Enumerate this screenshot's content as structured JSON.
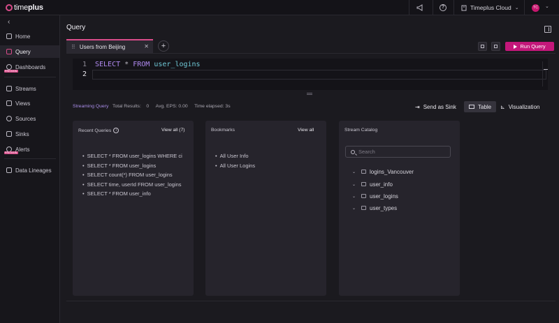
{
  "topbar": {
    "logo_prefix": "time",
    "logo_suffix": "plus",
    "workspace": "Timeplus Cloud",
    "avatar_initials": "TC"
  },
  "sidebar": {
    "items": [
      {
        "label": "Home"
      },
      {
        "label": "Query",
        "active": true
      },
      {
        "label": "Dashboards",
        "badge": "PREVIEW"
      },
      {
        "label": "Streams"
      },
      {
        "label": "Views"
      },
      {
        "label": "Sources"
      },
      {
        "label": "Sinks"
      },
      {
        "label": "Alerts",
        "badge": "PREVIEW"
      },
      {
        "label": "Data Lineages"
      }
    ]
  },
  "page": {
    "title": "Query"
  },
  "tabs": [
    {
      "label": "Users from Beijing"
    }
  ],
  "run_button": "Run Query",
  "editor": {
    "lines": [
      "1",
      "2"
    ],
    "keyword_select": "SELECT",
    "star": "*",
    "keyword_from": "FROM",
    "table": "user_logins"
  },
  "status": {
    "mode": "Streaming Query",
    "total_results_label": "Total Results:",
    "total_results": "0",
    "eps": "Avg. EPS: 0.00",
    "elapsed": "Time elapsed: 3s"
  },
  "views": {
    "sink": "Send as Sink",
    "table": "Table",
    "visualization": "Visualization"
  },
  "recent": {
    "title": "Recent Queries",
    "action": "View all (7)",
    "items": [
      "SELECT * FROM user_logins WHERE ci",
      "SELECT * FROM user_logins",
      "SELECT count(*) FROM user_logins",
      "SELECT time, userId FROM user_logins",
      "SELECT * FROM user_info"
    ]
  },
  "bookmarks": {
    "title": "Bookmarks",
    "action": "View all",
    "items": [
      "All User Info",
      "All User Logins"
    ]
  },
  "catalog": {
    "title": "Stream Catalog",
    "search_placeholder": "Search",
    "streams": [
      "logins_Vancouver",
      "user_info",
      "user_logins",
      "user_types"
    ]
  }
}
